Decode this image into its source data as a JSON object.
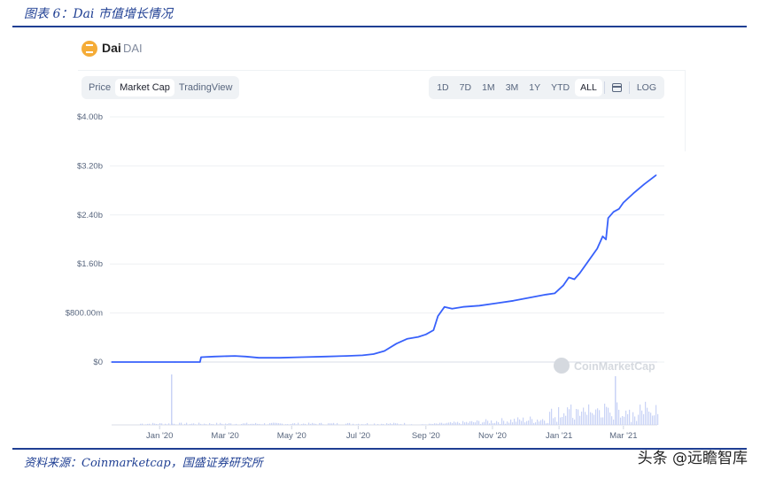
{
  "caption": "图表 6：Dai 市值增长情况",
  "source": "资料来源：Coinmarketcap，国盛证券研究所",
  "watermark": "头条 @远瞻智库",
  "coin": {
    "name": "Dai",
    "symbol": "DAI",
    "color": "#f5ac37"
  },
  "tabs": [
    "Price",
    "Market Cap",
    "TradingView"
  ],
  "active_tab": "Market Cap",
  "ranges": [
    "1D",
    "7D",
    "1M",
    "3M",
    "1Y",
    "YTD",
    "ALL"
  ],
  "active_range": "ALL",
  "log_label": "LOG",
  "chart_data": {
    "type": "line",
    "title": "",
    "series": [
      {
        "color": "#3861fb",
        "points": [
          [
            "2019-11-18",
            0.0
          ],
          [
            "2019-12-15",
            0.0
          ],
          [
            "2020-01-15",
            0.0
          ],
          [
            "2020-02-07",
            0.0
          ],
          [
            "2020-02-08",
            0.08
          ],
          [
            "2020-02-20",
            0.09
          ],
          [
            "2020-03-10",
            0.1
          ],
          [
            "2020-03-20",
            0.09
          ],
          [
            "2020-04-01",
            0.07
          ],
          [
            "2020-04-20",
            0.07
          ],
          [
            "2020-05-10",
            0.08
          ],
          [
            "2020-06-01",
            0.09
          ],
          [
            "2020-06-20",
            0.1
          ],
          [
            "2020-07-05",
            0.11
          ],
          [
            "2020-07-15",
            0.13
          ],
          [
            "2020-07-25",
            0.18
          ],
          [
            "2020-08-05",
            0.3
          ],
          [
            "2020-08-15",
            0.38
          ],
          [
            "2020-08-25",
            0.41
          ],
          [
            "2020-09-01",
            0.45
          ],
          [
            "2020-09-08",
            0.52
          ],
          [
            "2020-09-12",
            0.75
          ],
          [
            "2020-09-18",
            0.9
          ],
          [
            "2020-09-25",
            0.87
          ],
          [
            "2020-10-05",
            0.9
          ],
          [
            "2020-10-20",
            0.92
          ],
          [
            "2020-11-05",
            0.96
          ],
          [
            "2020-11-20",
            1.0
          ],
          [
            "2020-12-05",
            1.05
          ],
          [
            "2020-12-20",
            1.1
          ],
          [
            "2020-12-28",
            1.12
          ],
          [
            "2021-01-05",
            1.25
          ],
          [
            "2021-01-10",
            1.38
          ],
          [
            "2021-01-15",
            1.35
          ],
          [
            "2021-01-20",
            1.45
          ],
          [
            "2021-01-28",
            1.65
          ],
          [
            "2021-02-05",
            1.85
          ],
          [
            "2021-02-10",
            2.05
          ],
          [
            "2021-02-13",
            2.0
          ],
          [
            "2021-02-15",
            2.35
          ],
          [
            "2021-02-20",
            2.45
          ],
          [
            "2021-02-25",
            2.5
          ],
          [
            "2021-03-01",
            2.6
          ],
          [
            "2021-03-10",
            2.75
          ],
          [
            "2021-03-20",
            2.9
          ],
          [
            "2021-03-31",
            3.05
          ]
        ]
      }
    ],
    "x_range": [
      "2019-11-18",
      "2021-04-01"
    ],
    "y_range": [
      0,
      4.0
    ],
    "y_ticks": [
      0,
      0.8,
      1.6,
      2.4,
      3.2,
      4.0
    ],
    "y_tick_labels": [
      "$0",
      "$800.00m",
      "$1.60b",
      "$2.40b",
      "$3.20b",
      "$4.00b"
    ],
    "x_ticks": [
      "2020-01-01",
      "2020-03-01",
      "2020-05-01",
      "2020-07-01",
      "2020-09-01",
      "2020-11-01",
      "2021-01-01",
      "2021-03-01"
    ],
    "x_tick_labels": [
      "Jan '20",
      "Mar '20",
      "May '20",
      "Jul '20",
      "Sep '20",
      "Nov '20",
      "Jan '21",
      "Mar '21"
    ],
    "grid": true,
    "chart_watermark": "CoinMarketCap"
  }
}
